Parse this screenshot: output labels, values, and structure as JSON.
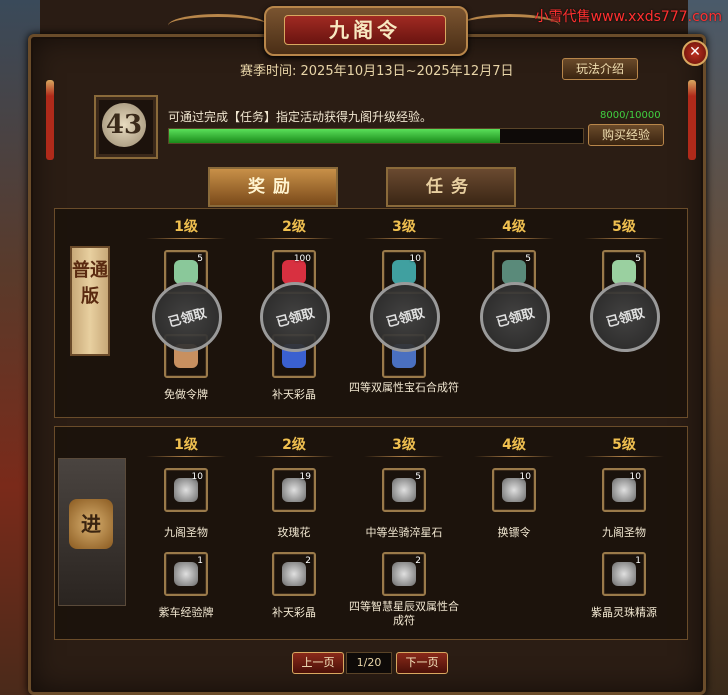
{
  "watermark": "小雪代售www.xxds777.com",
  "window": {
    "title": "九阁令",
    "close_label": "✕",
    "season": "赛季时间: 2025年10月13日~2025年12月7日",
    "rules_button": "玩法介绍"
  },
  "progress": {
    "level": "43",
    "description": "可通过完成【任务】指定活动获得九阁升级经验。",
    "value_text": "8000/10000",
    "fraction": 0.8,
    "buy_button": "购买经验"
  },
  "tabs": [
    {
      "label": "奖励",
      "active": true
    },
    {
      "label": "任务",
      "active": false
    }
  ],
  "tracks": {
    "normal_label": "普通版",
    "advanced_label": "进"
  },
  "levels": [
    "1级",
    "2级",
    "3级",
    "4级",
    "5级"
  ],
  "claimed_text": "已领取",
  "normal_rewards": [
    {
      "count": "5",
      "name": "免做令牌",
      "color": "#8ac89a",
      "claimed": true
    },
    {
      "count": "100",
      "name": "补天彩晶",
      "color": "#d83040",
      "claimed": true
    },
    {
      "count": "10",
      "name": "四等双属性宝石合成符",
      "color": "#40a0a0",
      "claimed": true
    },
    {
      "count": "5",
      "name": "",
      "color": "#5a8a7a",
      "claimed": true
    },
    {
      "count": "5",
      "name": "",
      "color": "#9ad0a0",
      "claimed": true
    }
  ],
  "normal_rewards_second": [
    {
      "count": "",
      "color": "#c89060"
    },
    {
      "count": "",
      "color": "#3a60d0"
    },
    {
      "count": "",
      "color": "#4a70c0"
    }
  ],
  "advanced_rewards_row1": [
    {
      "count": "10",
      "name": "九阁圣物"
    },
    {
      "count": "19",
      "name": "玫瑰花"
    },
    {
      "count": "5",
      "name": "中等坐骑淬星石"
    },
    {
      "count": "10",
      "name": "换镖令"
    },
    {
      "count": "10",
      "name": "九阁圣物"
    }
  ],
  "advanced_rewards_row2": [
    {
      "count": "1",
      "name": "紫车经验牌"
    },
    {
      "count": "2",
      "name": "补天彩晶"
    },
    {
      "count": "2",
      "name": "四等智慧星辰双属性合成符"
    },
    {
      "count": "1",
      "name": "紫晶灵珠精源"
    }
  ],
  "pager": {
    "prev": "上一页",
    "page": "1/20",
    "next": "下一页"
  }
}
